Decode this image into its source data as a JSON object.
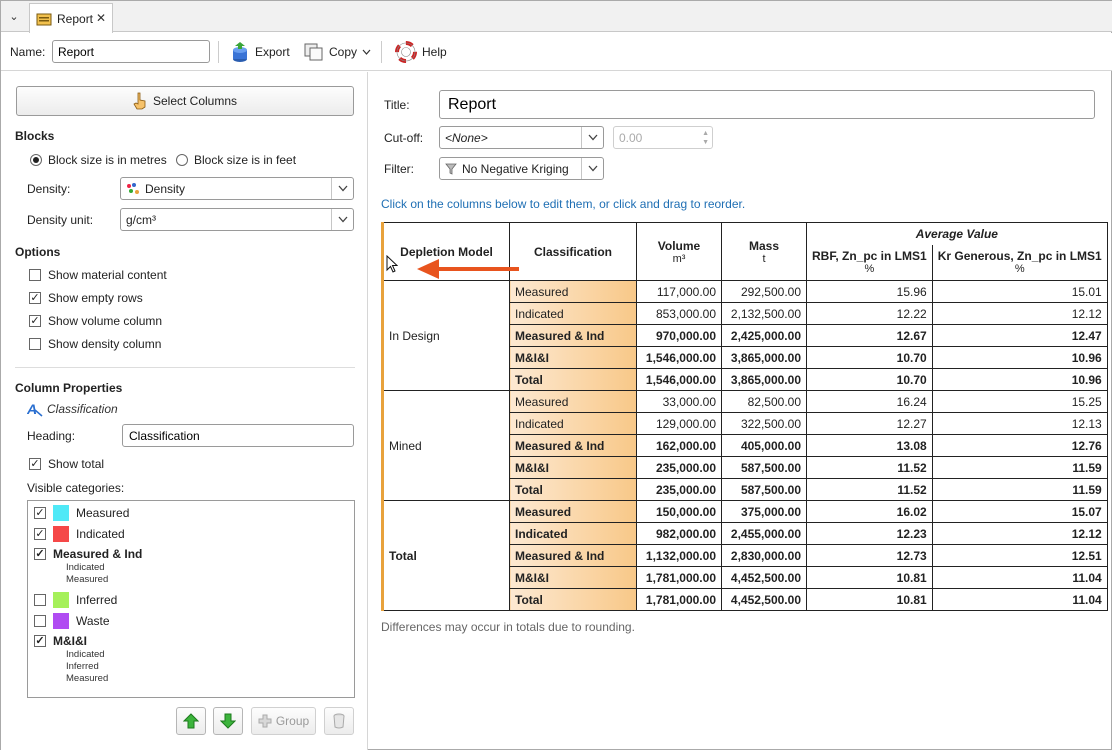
{
  "tab": {
    "menu_glyph": "⌄",
    "label": "Report",
    "close": "✕"
  },
  "toolbar": {
    "name_label": "Name:",
    "name_value": "Report",
    "export_label": "Export",
    "copy_label": "Copy",
    "help_label": "Help"
  },
  "left": {
    "select_columns": "Select Columns",
    "blocks": {
      "heading": "Blocks",
      "metres": "Block size is in metres",
      "feet": "Block size is in feet",
      "density_label": "Density:",
      "density_value": "Density",
      "density_unit_label": "Density unit:",
      "density_unit_value": "g/cm³"
    },
    "options": {
      "heading": "Options",
      "items": [
        {
          "label": "Show material content",
          "checked": false
        },
        {
          "label": "Show empty rows",
          "checked": true
        },
        {
          "label": "Show volume column",
          "checked": true
        },
        {
          "label": "Show density column",
          "checked": false
        }
      ]
    },
    "column_properties": {
      "heading": "Column Properties",
      "column_name": "Classification",
      "heading_label": "Heading:",
      "heading_value": "Classification",
      "show_total": "Show total",
      "visible_categories_label": "Visible categories:",
      "categories": [
        {
          "label": "Measured",
          "checked": true,
          "color": "#4fe9f7",
          "bold": false
        },
        {
          "label": "Indicated",
          "checked": true,
          "color": "#f54848",
          "bold": false
        },
        {
          "label": "Measured & Ind",
          "checked": true,
          "bold": true,
          "sub": [
            "Indicated",
            "Measured"
          ]
        },
        {
          "label": "Inferred",
          "checked": false,
          "color": "#a5f05a",
          "bold": false
        },
        {
          "label": "Waste",
          "checked": false,
          "color": "#b04cf2",
          "bold": false
        },
        {
          "label": "M&I&I",
          "checked": true,
          "bold": true,
          "sub": [
            "Indicated",
            "Inferred",
            "Measured"
          ]
        }
      ]
    },
    "group_button": "Group"
  },
  "right": {
    "title_label": "Title:",
    "title_value": "Report",
    "cutoff_label": "Cut-off:",
    "cutoff_value": "<None>",
    "cutoff_number": "0.00",
    "filter_label": "Filter:",
    "filter_value": "No Negative Kriging",
    "hint": "Click on the columns below to edit them, or click and drag to reorder.",
    "note": "Differences may occur in totals due to rounding."
  },
  "table": {
    "headers": {
      "depletion": "Depletion Model",
      "classification": "Classification",
      "volume": "Volume",
      "volume_unit": "m³",
      "mass": "Mass",
      "mass_unit": "t",
      "average_value": "Average Value",
      "rbf": "RBF, Zn_pc in LMS1",
      "rbf_unit": "%",
      "kr": "Kr Generous, Zn_pc in LMS1",
      "kr_unit": "%"
    },
    "groups": [
      {
        "name": "In Design",
        "bold": false,
        "rows": [
          {
            "cls": "Measured",
            "vol": "117,000.00",
            "mass": "292,500.00",
            "rbf": "15.96",
            "kr": "15.01",
            "bold": false
          },
          {
            "cls": "Indicated",
            "vol": "853,000.00",
            "mass": "2,132,500.00",
            "rbf": "12.22",
            "kr": "12.12",
            "bold": false
          },
          {
            "cls": "Measured & Ind",
            "vol": "970,000.00",
            "mass": "2,425,000.00",
            "rbf": "12.67",
            "kr": "12.47",
            "bold": true
          },
          {
            "cls": "M&I&I",
            "vol": "1,546,000.00",
            "mass": "3,865,000.00",
            "rbf": "10.70",
            "kr": "10.96",
            "bold": true
          },
          {
            "cls": "Total",
            "vol": "1,546,000.00",
            "mass": "3,865,000.00",
            "rbf": "10.70",
            "kr": "10.96",
            "bold": true
          }
        ]
      },
      {
        "name": "Mined",
        "bold": false,
        "rows": [
          {
            "cls": "Measured",
            "vol": "33,000.00",
            "mass": "82,500.00",
            "rbf": "16.24",
            "kr": "15.25",
            "bold": false
          },
          {
            "cls": "Indicated",
            "vol": "129,000.00",
            "mass": "322,500.00",
            "rbf": "12.27",
            "kr": "12.13",
            "bold": false
          },
          {
            "cls": "Measured & Ind",
            "vol": "162,000.00",
            "mass": "405,000.00",
            "rbf": "13.08",
            "kr": "12.76",
            "bold": true
          },
          {
            "cls": "M&I&I",
            "vol": "235,000.00",
            "mass": "587,500.00",
            "rbf": "11.52",
            "kr": "11.59",
            "bold": true
          },
          {
            "cls": "Total",
            "vol": "235,000.00",
            "mass": "587,500.00",
            "rbf": "11.52",
            "kr": "11.59",
            "bold": true
          }
        ]
      },
      {
        "name": "Total",
        "bold": true,
        "rows": [
          {
            "cls": "Measured",
            "vol": "150,000.00",
            "mass": "375,000.00",
            "rbf": "16.02",
            "kr": "15.07",
            "bold": true
          },
          {
            "cls": "Indicated",
            "vol": "982,000.00",
            "mass": "2,455,000.00",
            "rbf": "12.23",
            "kr": "12.12",
            "bold": true
          },
          {
            "cls": "Measured & Ind",
            "vol": "1,132,000.00",
            "mass": "2,830,000.00",
            "rbf": "12.73",
            "kr": "12.51",
            "bold": true
          },
          {
            "cls": "M&I&I",
            "vol": "1,781,000.00",
            "mass": "4,452,500.00",
            "rbf": "10.81",
            "kr": "11.04",
            "bold": true
          },
          {
            "cls": "Total",
            "vol": "1,781,000.00",
            "mass": "4,452,500.00",
            "rbf": "10.81",
            "kr": "11.04",
            "bold": true
          }
        ]
      }
    ]
  },
  "colors": {
    "accent_orange": "#e8a23c",
    "link_blue": "#1f6fb4",
    "arrow_red": "#e8541e"
  }
}
